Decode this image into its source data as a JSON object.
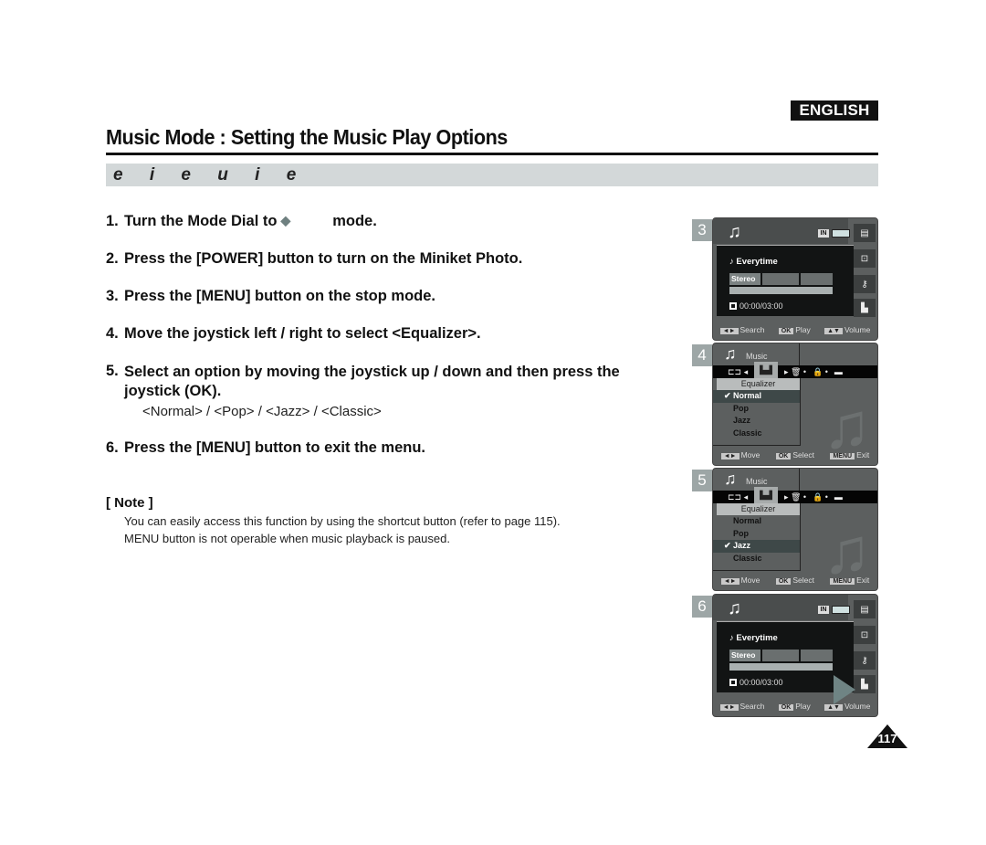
{
  "header": {
    "language": "ENGLISH",
    "title": "Music Mode : Setting the Music Play Options",
    "section": "e i  e u i e"
  },
  "steps": [
    {
      "num": "1.",
      "text_before": "Turn the Mode Dial to",
      "icon": "diamond-mode-icon",
      "text_after": "mode."
    },
    {
      "num": "2.",
      "text": "Press the [POWER] button to turn on the Miniket Photo."
    },
    {
      "num": "3.",
      "text": "Press the [MENU] button on the stop mode."
    },
    {
      "num": "4.",
      "text": "Move the joystick left / right to select <Equalizer>."
    },
    {
      "num": "5.",
      "text": "Select an option by moving the joystick up / down and then press the joystick (OK)."
    },
    {
      "num": "6.",
      "text": "Press the [MENU] button to exit the menu."
    }
  ],
  "options_line": "<Normal> / <Pop> / <Jazz> / <Classic>",
  "note": {
    "title": "[ Note ]",
    "lines": [
      "You can easily access this function by using the shortcut button (refer to page 115).",
      "MENU button is not operable when music playback is paused."
    ]
  },
  "screens": {
    "s3": {
      "num": "3",
      "in_badge": "IN",
      "track": "Everytime",
      "audio": "Stereo",
      "time": "00:00/03:00",
      "footer": [
        {
          "key": "◄►",
          "label": "Search"
        },
        {
          "key": "OK",
          "label": "Play"
        },
        {
          "key": "▲▼",
          "label": "Volume"
        }
      ]
    },
    "s4": {
      "num": "4",
      "menu_title": "Music",
      "menu_header": "Equalizer",
      "items": [
        "Normal",
        "Pop",
        "Jazz",
        "Classic"
      ],
      "selected": "Normal",
      "footer": [
        {
          "key": "◄►",
          "label": "Move"
        },
        {
          "key": "OK",
          "label": "Select"
        },
        {
          "key": "MENU",
          "label": "Exit"
        }
      ]
    },
    "s5": {
      "num": "5",
      "menu_title": "Music",
      "menu_header": "Equalizer",
      "items": [
        "Normal",
        "Pop",
        "Jazz",
        "Classic"
      ],
      "selected": "Jazz",
      "footer": [
        {
          "key": "◄►",
          "label": "Move"
        },
        {
          "key": "OK",
          "label": "Select"
        },
        {
          "key": "MENU",
          "label": "Exit"
        }
      ]
    },
    "s6": {
      "num": "6",
      "in_badge": "IN",
      "track": "Everytime",
      "audio": "Stereo",
      "time": "00:00/03:00",
      "footer": [
        {
          "key": "◄►",
          "label": "Search"
        },
        {
          "key": "OK",
          "label": "Play"
        },
        {
          "key": "▲▼",
          "label": "Volume"
        }
      ]
    }
  },
  "page_number": "117"
}
